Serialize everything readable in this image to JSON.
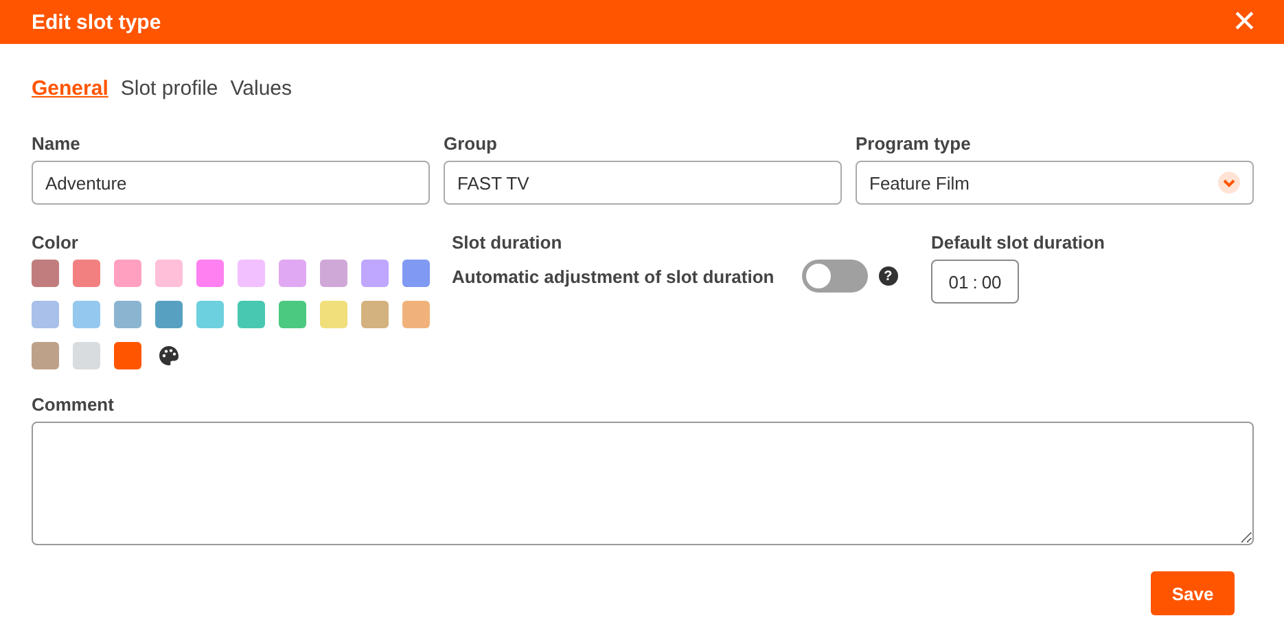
{
  "window": {
    "title": "Edit slot type",
    "close": "✕"
  },
  "tabs": [
    {
      "label": "General",
      "selected": true
    },
    {
      "label": "Slot profile",
      "selected": false
    },
    {
      "label": "Values",
      "selected": false
    }
  ],
  "fields": [
    {
      "label": "Name",
      "value": "Adventure",
      "kind": "text"
    },
    {
      "label": "Group",
      "value": "FAST TV",
      "kind": "text"
    },
    {
      "label": "Program type",
      "value": "Feature Film",
      "kind": "select"
    }
  ],
  "color": {
    "label": "Color",
    "swatches": [
      {
        "color": "#c17d7d"
      },
      {
        "color": "#f28080"
      },
      {
        "color": "#ffa0c0"
      },
      {
        "color": "#ffbfd9"
      },
      {
        "color": "#ff80f0"
      },
      {
        "color": "#f2c0ff"
      },
      {
        "color": "#e0a8f2"
      },
      {
        "color": "#d0a8d8"
      },
      {
        "color": "#bfa6ff"
      },
      {
        "color": "#8099f2"
      },
      {
        "color": "#a8c0ea"
      },
      {
        "color": "#95c8ef"
      },
      {
        "color": "#8bb4d0"
      },
      {
        "color": "#58a0c2"
      },
      {
        "color": "#6cd0de"
      },
      {
        "color": "#48c8b0"
      },
      {
        "color": "#4cc980"
      },
      {
        "color": "#f0df7a"
      },
      {
        "color": "#d4b27f"
      },
      {
        "color": "#f0b27a"
      },
      {
        "color": "#bda189"
      },
      {
        "color": "#d9dcde"
      },
      {
        "color": "#ff5500"
      }
    ]
  },
  "slot_duration": {
    "label": "Slot duration",
    "toggle_label": "Automatic adjustment of slot duration",
    "on": false,
    "help": "?"
  },
  "default_duration": {
    "label": "Default slot duration",
    "hours": "01",
    "separator": ":",
    "minutes": "00"
  },
  "comment": {
    "label": "Comment"
  },
  "buttons": [
    "Save"
  ]
}
